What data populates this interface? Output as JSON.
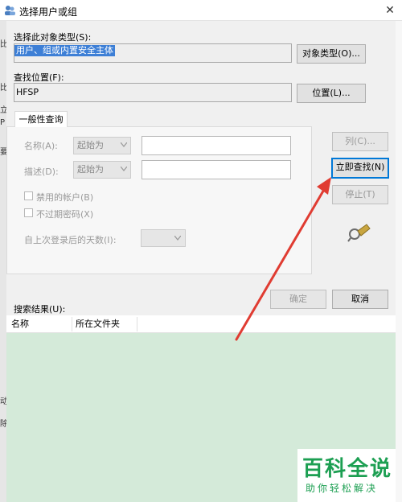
{
  "window": {
    "title": "选择用户或组",
    "close_glyph": "✕"
  },
  "object_type": {
    "label": "选择此对象类型(S):",
    "value": "用户、组或内置安全主体",
    "button": "对象类型(O)..."
  },
  "location": {
    "label": "查找位置(F):",
    "value": "HFSP",
    "button": "位置(L)..."
  },
  "query": {
    "tab": "一般性查询",
    "name_label": "名称(A):",
    "name_mode": "起始为",
    "desc_label": "描述(D):",
    "desc_mode": "起始为",
    "disabled_accounts": "禁用的帐户(B)",
    "non_expiring": "不过期密码(X)",
    "days_label": "自上次登录后的天数(I):"
  },
  "side_buttons": {
    "columns": "列(C)...",
    "find_now": "立即查找(N)",
    "stop": "停止(T)"
  },
  "footer": {
    "ok": "确定",
    "cancel": "取消"
  },
  "results": {
    "label": "搜索结果(U):",
    "columns": [
      "名称",
      "所在文件夹"
    ]
  },
  "watermark": {
    "main": "百科全说",
    "sub": "助你轻松解决"
  },
  "left_strip": [
    "比",
    "比",
    "立",
    "P",
    "要",
    "动",
    "除"
  ],
  "colors": {
    "accent": "#0078d7",
    "selection": "#3d7fd6",
    "arrow": "#e03c32",
    "results_bg": "#d4ead9",
    "watermark": "#1c9f52"
  }
}
